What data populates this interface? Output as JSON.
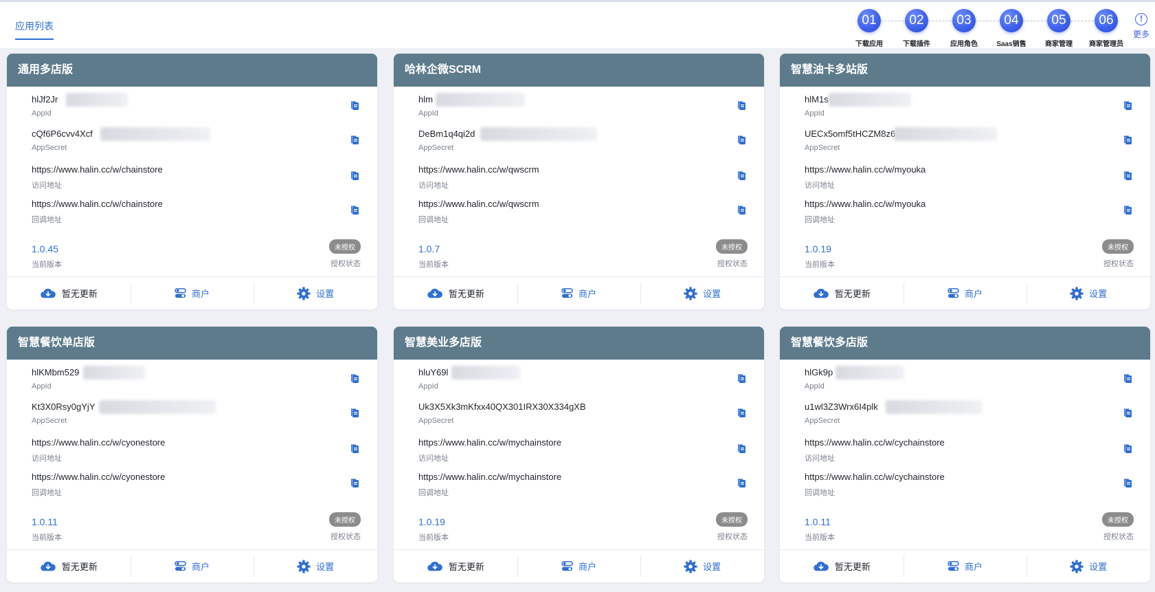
{
  "nav": {
    "active_tab": "应用列表"
  },
  "steps": [
    {
      "num": "01",
      "label": "下载应用"
    },
    {
      "num": "02",
      "label": "下载插件"
    },
    {
      "num": "03",
      "label": "应用角色"
    },
    {
      "num": "04",
      "label": "Saas销售"
    },
    {
      "num": "05",
      "label": "商家管理"
    },
    {
      "num": "06",
      "label": "商家管理员"
    }
  ],
  "more": {
    "icon": "!",
    "label": "更多"
  },
  "labels": {
    "appid": "AppId",
    "appsecret": "AppSecret",
    "access_url": "访问地址",
    "callback_url": "回调地址",
    "current_version": "当前版本",
    "auth_status": "授权状态",
    "auth_badge": "未授权",
    "btn_update": "暂无更新",
    "btn_merchant": "商户",
    "btn_settings": "设置"
  },
  "colors": {
    "header": "#5d7b8b",
    "accent": "#2f6fd3",
    "badge": "#8c8c8c"
  },
  "cards": [
    {
      "title": "通用多店版",
      "appid": "hlJf2Jr",
      "appsecret": "cQf6P6cvv4Xcf",
      "access_url": "https://www.halin.cc/w/chainstore",
      "callback_url": "https://www.halin.cc/w/chainstore",
      "version": "1.0.45"
    },
    {
      "title": "哈林企微SCRM",
      "appid": "hlm",
      "appsecret": "DeBm1q4qi2d",
      "access_url": "https://www.halin.cc/w/qwscrm",
      "callback_url": "https://www.halin.cc/w/qwscrm",
      "version": "1.0.7"
    },
    {
      "title": "智慧油卡多站版",
      "appid": "hlM1s",
      "appsecret": "UECx5omf5tHCZM8z6",
      "access_url": "https://www.halin.cc/w/myouka",
      "callback_url": "https://www.halin.cc/w/myouka",
      "version": "1.0.19"
    },
    {
      "title": "智慧餐饮单店版",
      "appid": "hlKMbm529",
      "appsecret": "Kt3X0Rsy0gYjY",
      "access_url": "https://www.halin.cc/w/cyonestore",
      "callback_url": "https://www.halin.cc/w/cyonestore",
      "version": "1.0.11"
    },
    {
      "title": "智慧美业多店版",
      "appid": "hluY69l",
      "appsecret": "Uk3X5Xk3mKfxx40QX301IRX30X334gXB",
      "access_url": "https://www.halin.cc/w/mychainstore",
      "callback_url": "https://www.halin.cc/w/mychainstore",
      "version": "1.0.19"
    },
    {
      "title": "智慧餐饮多店版",
      "appid": "hlGk9p",
      "appsecret": "u1wl3Z3Wrx6I4plk",
      "access_url": "https://www.halin.cc/w/cychainstore",
      "callback_url": "https://www.halin.cc/w/cychainstore",
      "version": "1.0.11"
    }
  ]
}
